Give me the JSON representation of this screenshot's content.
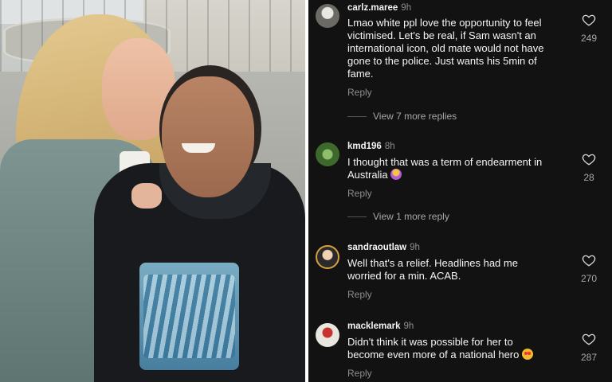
{
  "comments": [
    {
      "username": "carlz.maree",
      "time": "9h",
      "text_lines": [
        "Lmao white ppl love the opportunity to feel",
        "victimised.  Let's be real, if Sam wasn't an",
        "international icon, old mate would not have",
        "gone to the police. Just wants his 5min of",
        "fame."
      ],
      "reply_label": "Reply",
      "likes": "249",
      "view_replies": "View 7 more replies"
    },
    {
      "username": "kmd196",
      "time": "8h",
      "text_lines": [
        "I thought that was a term of endearment in",
        "Australia"
      ],
      "reply_label": "Reply",
      "likes": "28",
      "view_replies": "View 1 more reply"
    },
    {
      "username": "sandraoutlaw",
      "time": "9h",
      "text_lines": [
        "Well that's a relief. Headlines had me",
        "worried for a min. ACAB."
      ],
      "reply_label": "Reply",
      "likes": "270"
    },
    {
      "username": "macklemark",
      "time": "9h",
      "text_lines": [
        "Didn't think it was possible for her to",
        "become even more of a national hero"
      ],
      "reply_label": "Reply",
      "likes": "287"
    }
  ],
  "icons": {
    "like": "heart-icon",
    "emoji_1": "person-shrugging-emoji",
    "emoji_2": "heart-eyes-emoji"
  },
  "colors": {
    "panel_bg": "#121212",
    "text": "#f5f5f5",
    "muted": "#8e8e8e"
  }
}
